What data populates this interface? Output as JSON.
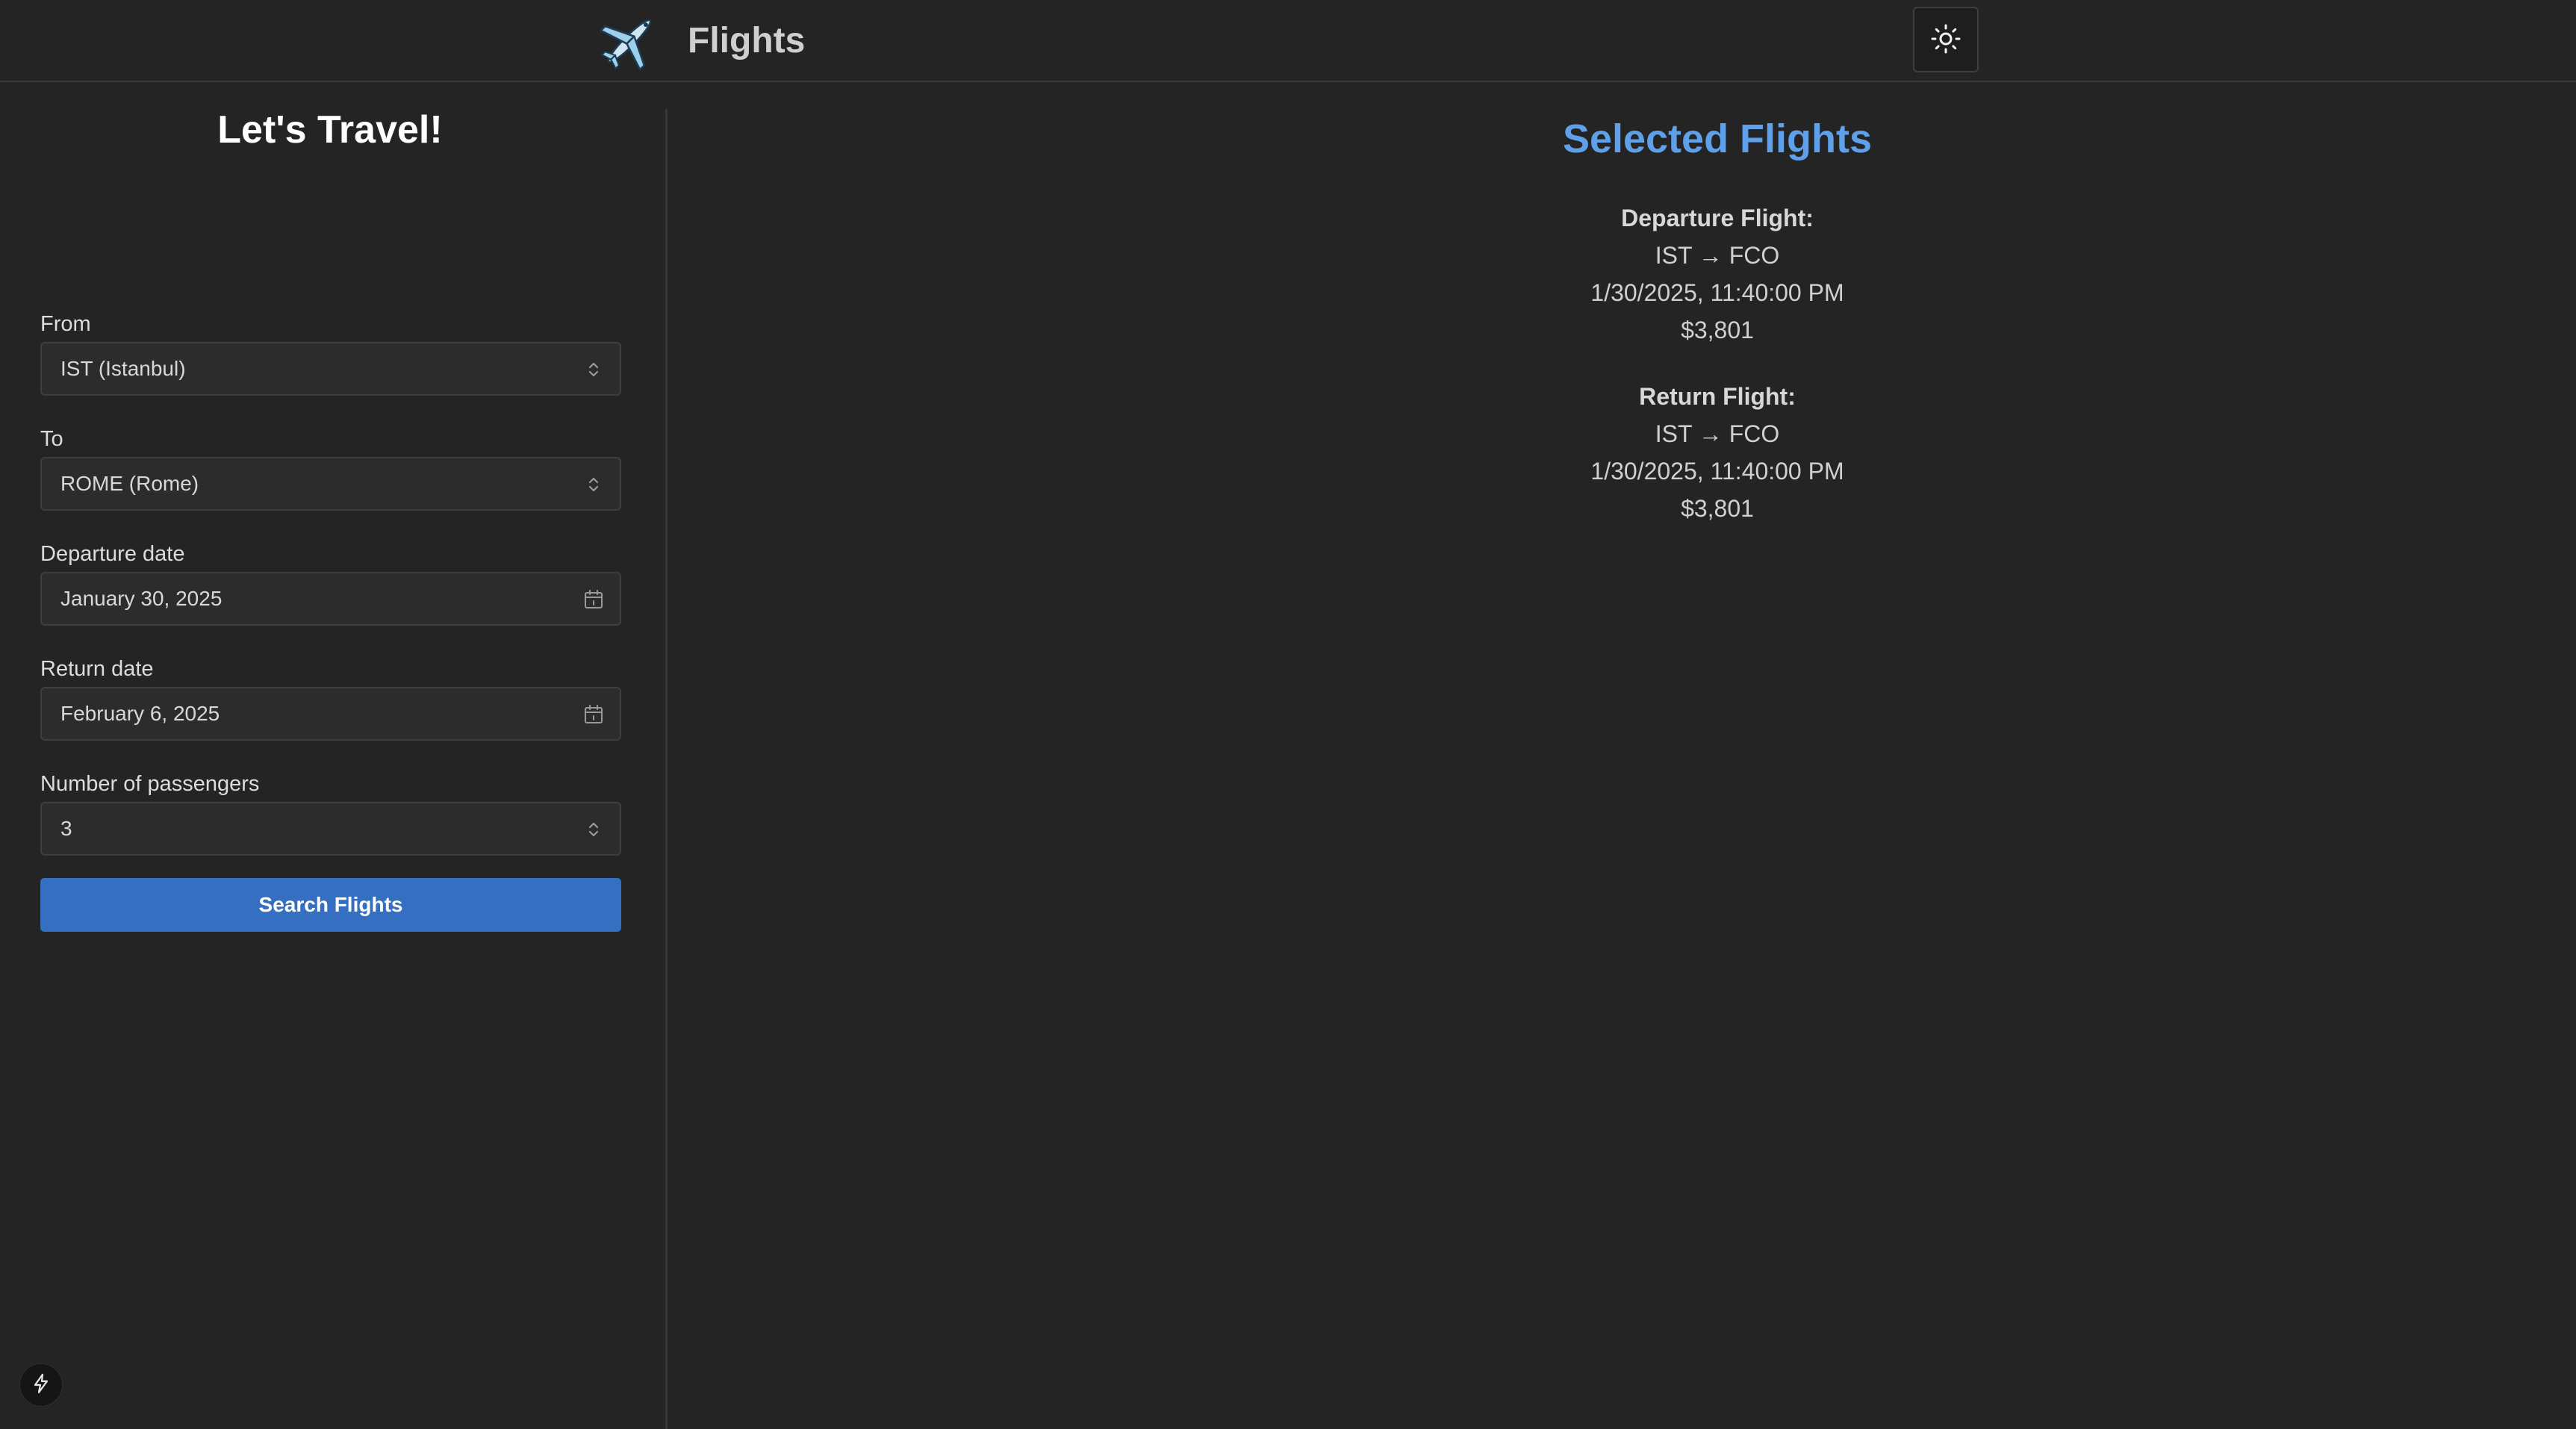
{
  "header": {
    "app_title": "Flights",
    "logo_icon": "airplane-icon",
    "theme_toggle_icon": "sun-icon"
  },
  "sidebar": {
    "title": "Let's Travel!",
    "from": {
      "label": "From",
      "value": "IST (Istanbul)",
      "icon": "chevron-updown-icon"
    },
    "to": {
      "label": "To",
      "value": "ROME (Rome)",
      "icon": "chevron-updown-icon"
    },
    "departure_date": {
      "label": "Departure date",
      "value": "January 30, 2025",
      "icon": "calendar-icon"
    },
    "return_date": {
      "label": "Return date",
      "value": "February 6, 2025",
      "icon": "calendar-icon"
    },
    "passengers": {
      "label": "Number of passengers",
      "value": "3",
      "icon": "chevron-updown-icon"
    },
    "search_button_label": "Search Flights",
    "bolt_icon": "lightning-bolt-icon"
  },
  "main": {
    "title": "Selected Flights",
    "departure": {
      "heading": "Departure Flight:",
      "route": "IST → FCO",
      "datetime": "1/30/2025, 11:40:00 PM",
      "price": "$3,801"
    },
    "return": {
      "heading": "Return Flight:",
      "route": "IST → FCO",
      "datetime": "1/30/2025, 11:40:00 PM",
      "price": "$3,801"
    }
  },
  "colors": {
    "background": "#242424",
    "accent_title": "#5fa0eb",
    "button": "#356fc2"
  }
}
